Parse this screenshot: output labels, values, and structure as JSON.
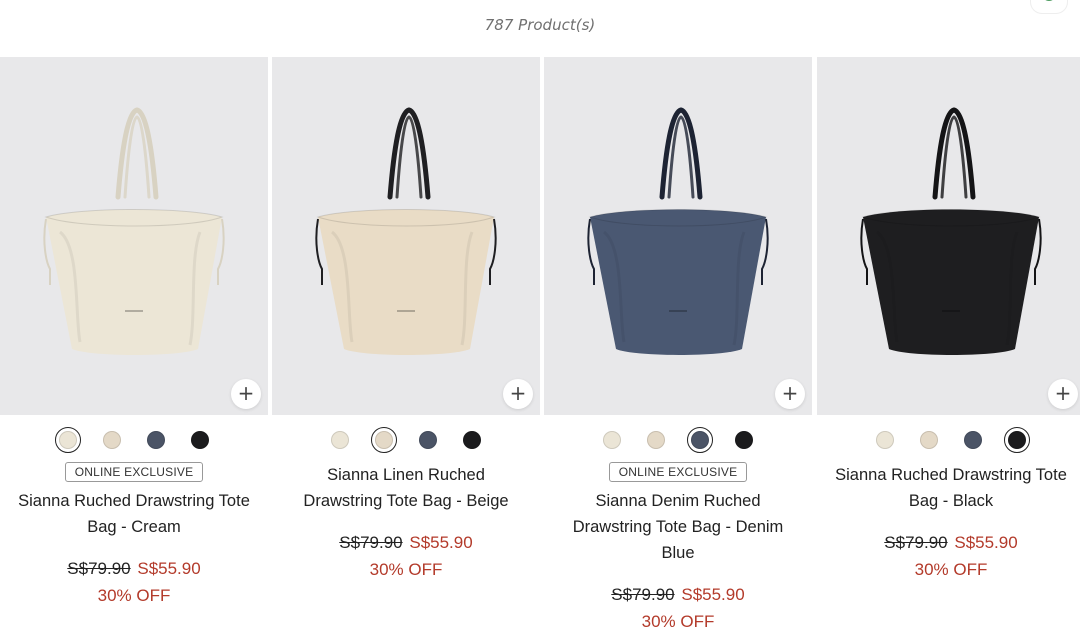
{
  "header": {
    "product_count": "787 Product(s)"
  },
  "add_label": "+",
  "products": [
    {
      "badge": "ONLINE EXCLUSIVE",
      "name": "Sianna Ruched Drawstring Tote Bag - Cream",
      "original_price": "S$79.90",
      "sale_price": "S$55.90",
      "discount": "30% OFF",
      "bag_color": "#ece6d6",
      "strap_color": "#d8d2c2",
      "selected_swatch": 0
    },
    {
      "badge": "",
      "name": "Sianna Linen Ruched Drawstring Tote Bag - Beige",
      "original_price": "S$79.90",
      "sale_price": "S$55.90",
      "discount": "30% OFF",
      "bag_color": "#e9dcc6",
      "strap_color": "#1f1f22",
      "selected_swatch": 1
    },
    {
      "badge": "ONLINE EXCLUSIVE",
      "name": "Sianna Denim Ruched Drawstring Tote Bag - Denim Blue",
      "original_price": "S$79.90",
      "sale_price": "S$55.90",
      "discount": "30% OFF",
      "bag_color": "#4a5872",
      "strap_color": "#1d2333",
      "selected_swatch": 2
    },
    {
      "badge": "",
      "name": "Sianna Ruched Drawstring Tote Bag - Black",
      "original_price": "S$79.90",
      "sale_price": "S$55.90",
      "discount": "30% OFF",
      "bag_color": "#1e1e20",
      "strap_color": "#141416",
      "selected_swatch": 3
    }
  ],
  "swatch_colors": [
    "#ebe5d6",
    "#e4d9c7",
    "#4b5466",
    "#1b1b1d"
  ]
}
